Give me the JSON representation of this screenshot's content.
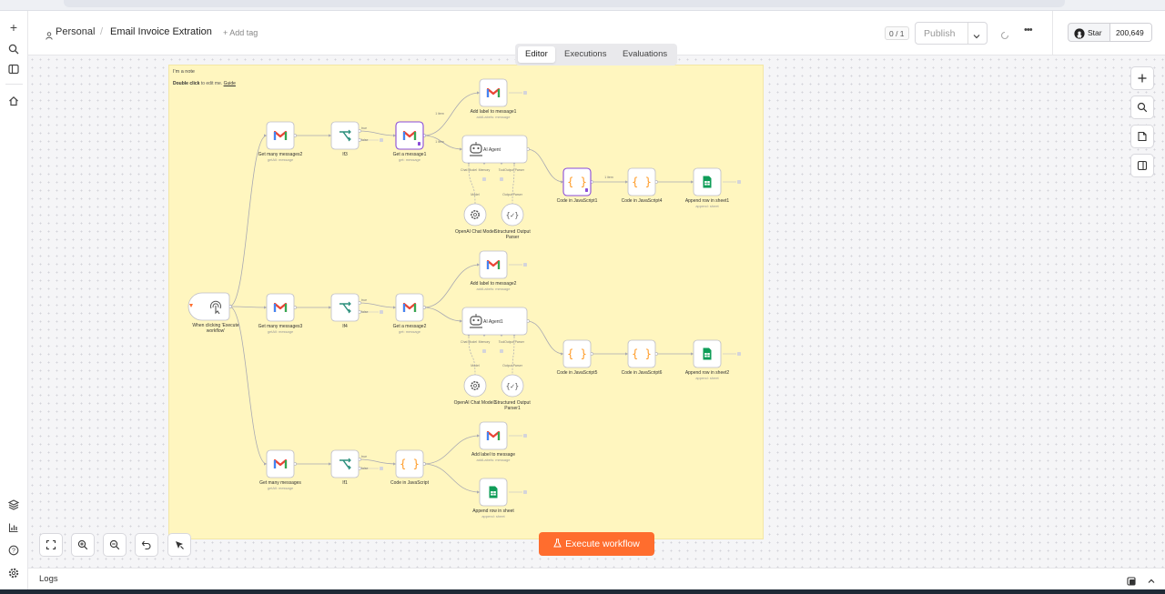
{
  "header": {
    "breadcrumb_project": "Personal",
    "workflow_name": "Email Invoice Extration",
    "add_tag": "+ Add tag",
    "page_count": "0 / 1",
    "publish": "Publish",
    "github_star": "Star",
    "github_count": "200,649"
  },
  "tabs": [
    "Editor",
    "Executions",
    "Evaluations"
  ],
  "note": {
    "title": "I'm a note",
    "edit_bold": "Double click",
    "edit_text": " to edit me. ",
    "guide": "Guide"
  },
  "nodes": {
    "trigger": {
      "label": "When clicking 'Execute workflow'"
    },
    "gm2": {
      "label": "Get many messages2",
      "sub": "getAll: message"
    },
    "gm3": {
      "label": "Get many messages3",
      "sub": "getAll: message"
    },
    "gm": {
      "label": "Get many messages",
      "sub": "getAll: message"
    },
    "if3": {
      "label": "If3",
      "t": "true",
      "f": "false"
    },
    "if4": {
      "label": "If4",
      "t": "true",
      "f": "false"
    },
    "if1": {
      "label": "If1",
      "t": "true",
      "f": "false"
    },
    "getmsg1": {
      "label": "Get a message1",
      "sub": "get: message",
      "edge": "1 item"
    },
    "getmsg2": {
      "label": "Get a message2",
      "sub": "get: message"
    },
    "addlabel1": {
      "label": "Add label to message1",
      "sub": "addLabels: message",
      "edge": "1 item"
    },
    "addlabel2": {
      "label": "Add label to message2",
      "sub": "addLabels: message"
    },
    "addlabel": {
      "label": "Add label to message",
      "sub": "addLabels: message"
    },
    "agent": {
      "label": "AI Agent",
      "p1": "Chat Model",
      "p2": "Memory",
      "p3": "Tool",
      "p4": "Output Parser"
    },
    "agent1": {
      "label": "AI Agent1",
      "p1": "Chat Model",
      "p2": "Memory",
      "p3": "Tool",
      "p4": "Output Parser"
    },
    "chat": {
      "label": "OpenAI Chat Model",
      "edge": "Model"
    },
    "chat1": {
      "label": "OpenAI Chat Model1",
      "edge": "Model"
    },
    "parser": {
      "label": "Structured Output Parser",
      "edge": "Output Parser"
    },
    "parser1": {
      "label": "Structured Output Parser1",
      "edge": "Output Parser"
    },
    "code1": {
      "label": "Code in JavaScript1",
      "edge": "1 item"
    },
    "code4": {
      "label": "Code in JavaScript4"
    },
    "code5": {
      "label": "Code in JavaScript5"
    },
    "code6": {
      "label": "Code in JavaScript6"
    },
    "code": {
      "label": "Code in JavaScript"
    },
    "append1": {
      "label": "Append row in sheet1",
      "sub": "append: sheet"
    },
    "append2": {
      "label": "Append row in sheet2",
      "sub": "append: sheet"
    },
    "append": {
      "label": "Append row in sheet",
      "sub": "append: sheet"
    }
  },
  "execute_button": "Execute workflow",
  "logs": "Logs",
  "colors": {
    "accent": "#ff6d2e",
    "note_bg": "#fff6bf",
    "gmail_red": "#ea4335",
    "sheets_green": "#0f9d58",
    "code_orange": "#ff9b26",
    "if_green": "#2b8f7c"
  }
}
